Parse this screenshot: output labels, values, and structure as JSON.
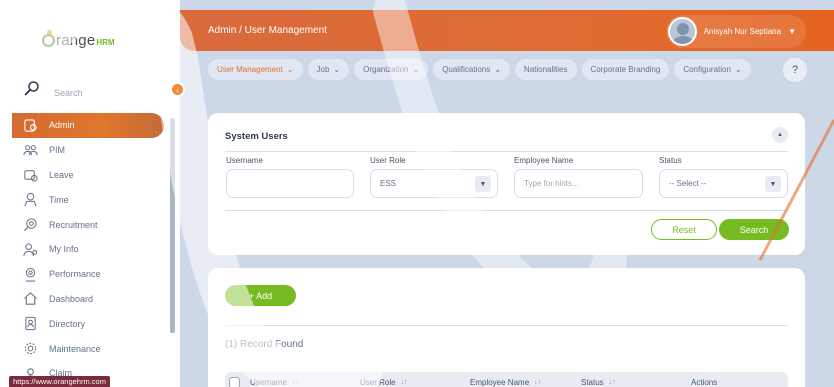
{
  "brand": {
    "name": "range",
    "suffix": "HRM"
  },
  "sidebar": {
    "search_placeholder": "Search",
    "collapse_icon": "chevron-left",
    "items": [
      {
        "label": "Admin",
        "icon": "admin-icon",
        "active": true
      },
      {
        "label": "PIM",
        "icon": "pim-icon"
      },
      {
        "label": "Leave",
        "icon": "leave-icon"
      },
      {
        "label": "Time",
        "icon": "time-icon"
      },
      {
        "label": "Recruitment",
        "icon": "recruitment-icon"
      },
      {
        "label": "My Info",
        "icon": "my-info-icon"
      },
      {
        "label": "Performance",
        "icon": "performance-icon"
      },
      {
        "label": "Dashboard",
        "icon": "dashboard-icon"
      },
      {
        "label": "Directory",
        "icon": "directory-icon"
      },
      {
        "label": "Maintenance",
        "icon": "maintenance-icon"
      },
      {
        "label": "Claim",
        "icon": "claim-icon"
      }
    ]
  },
  "header": {
    "breadcrumb": "Admin / User Management",
    "user_name": "Anisyah Nur Septiana"
  },
  "tabs": [
    {
      "label": "User Management",
      "dropdown": true,
      "active": true
    },
    {
      "label": "Job",
      "dropdown": true
    },
    {
      "label": "Organization",
      "dropdown": true
    },
    {
      "label": "Qualifications",
      "dropdown": true
    },
    {
      "label": "Nationalities",
      "dropdown": false
    },
    {
      "label": "Corporate Branding",
      "dropdown": false
    },
    {
      "label": "Configuration",
      "dropdown": true
    }
  ],
  "help_label": "?",
  "filter": {
    "title": "System Users",
    "fields": {
      "username": {
        "label": "Username",
        "value": ""
      },
      "user_role": {
        "label": "User Role",
        "value": "ESS"
      },
      "employee_name": {
        "label": "Employee Name",
        "placeholder": "Type for hints..."
      },
      "status": {
        "label": "Status",
        "value": "-- Select --"
      }
    },
    "reset_label": "Reset",
    "search_label": "Search"
  },
  "results": {
    "add_label": "+ Add",
    "record_count": "(1) Record Found",
    "columns": [
      "Username",
      "User Role",
      "Employee Name",
      "Status",
      "Actions"
    ]
  },
  "status_url": "https://www.orangehrm.com",
  "colors": {
    "accent": "#e06c33",
    "green": "#76bc21",
    "text": "#64728c"
  }
}
